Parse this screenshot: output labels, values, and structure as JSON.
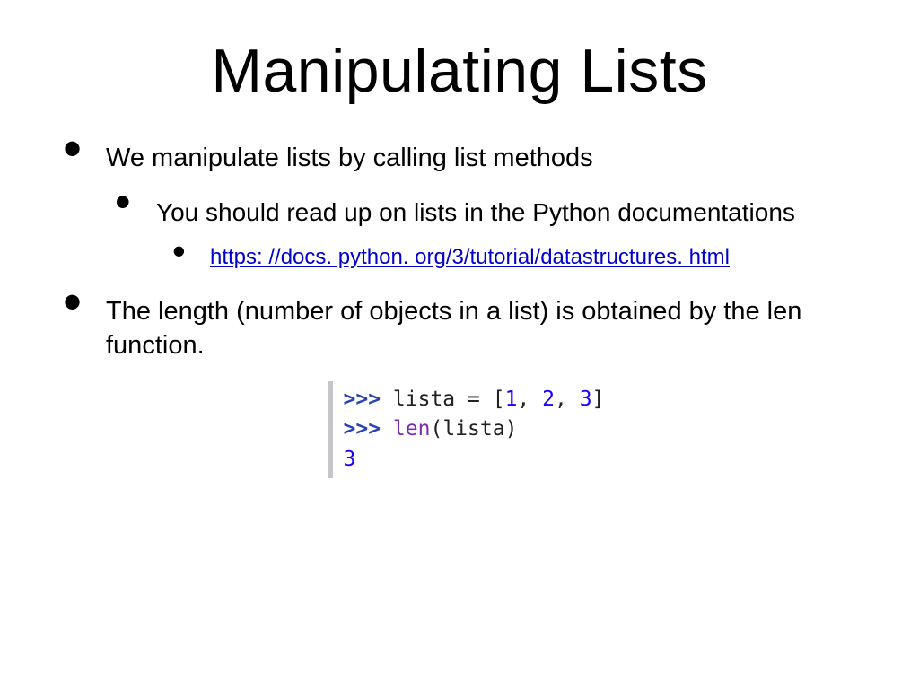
{
  "title": "Manipulating Lists",
  "bullets": {
    "b1": "We manipulate lists by calling list methods",
    "b1_1": "You should read up on lists in the Python documentations",
    "b1_1_link": "https: //docs. python. org/3/tutorial/datastructures. html",
    "b2": "The length (number of objects in a list) is obtained by the len function."
  },
  "code": {
    "prompt": ">>>",
    "line1_ident": "lista",
    "line1_eq": " = ",
    "line1_open": "[",
    "line1_v1": "1",
    "line1_c1": ", ",
    "line1_v2": "2",
    "line1_c2": ", ",
    "line1_v3": "3",
    "line1_close": "]",
    "line2_func": "len",
    "line2_open": "(",
    "line2_arg": "lista",
    "line2_close": ")",
    "line3_out": "3"
  }
}
